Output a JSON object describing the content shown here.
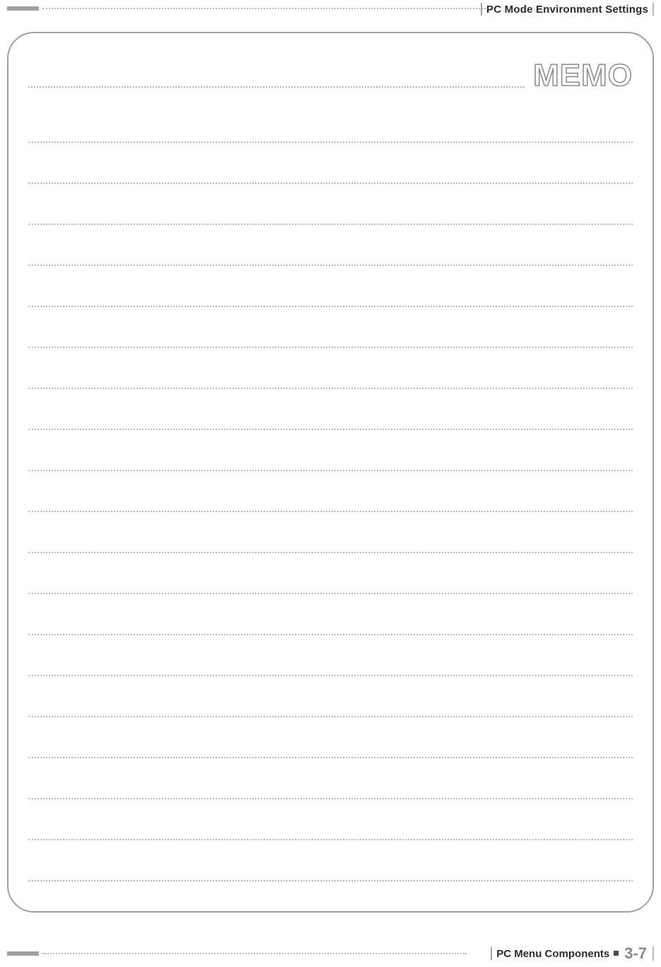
{
  "header": {
    "title": "PC Mode Environment Settings"
  },
  "memo": {
    "title": "MEMO",
    "line_count": 19
  },
  "footer": {
    "section": "PC Menu Components",
    "page": "3-7"
  }
}
